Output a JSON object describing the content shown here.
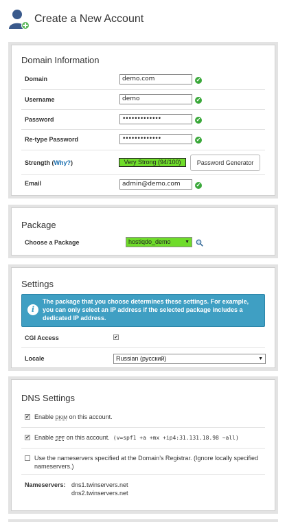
{
  "header": {
    "title": "Create a New Account"
  },
  "domain_info": {
    "title": "Domain Information",
    "domain_label": "Domain",
    "domain_value": "demo.com",
    "username_label": "Username",
    "username_value": "demo",
    "password_label": "Password",
    "password_value": "•••••••••••••",
    "retype_label": "Re-type Password",
    "retype_value": "•••••••••••••",
    "strength_label": "Strength (",
    "strength_why": "Why?",
    "strength_close": ")",
    "strength_value": "Very Strong (94/100)",
    "generator_button": "Password Generator",
    "email_label": "Email",
    "email_value": "admin@demo.com",
    "valid_mark": "✔"
  },
  "package": {
    "title": "Package",
    "choose_label": "Choose a Package",
    "selected": "hostiqdo_demo",
    "search_icon": "⚲"
  },
  "settings": {
    "title": "Settings",
    "info_text": "The package that you choose determines these settings. For example, you can only select an IP address if the selected package includes a dedicated IP address.",
    "cgi_label": "CGI Access",
    "cgi_checked": "✔",
    "locale_label": "Locale",
    "locale_value": "Russian (русский)"
  },
  "dns": {
    "title": "DNS Settings",
    "dkim_prefix": "Enable",
    "dkim_abbr": "DKIM",
    "dkim_suffix": "on this account.",
    "spf_prefix": "Enable",
    "spf_abbr": "SPF",
    "spf_suffix": "on this account.",
    "spf_record": "(v=spf1 +a +mx +ip4:31.131.18.98 ~all)",
    "check_mark": "✔",
    "registrar_text": "Use the nameservers specified at the Domain’s Registrar. (Ignore locally specified nameservers.)",
    "nameservers_label": "Nameservers:",
    "ns1": "dns1.twinservers.net",
    "ns2": "dns2.twinservers.net"
  }
}
